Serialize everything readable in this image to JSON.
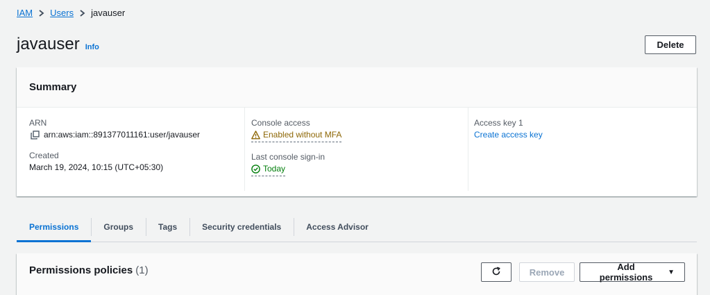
{
  "breadcrumb": {
    "items": [
      {
        "label": "IAM"
      },
      {
        "label": "Users"
      }
    ],
    "current": "javauser"
  },
  "header": {
    "title": "javauser",
    "info_label": "Info",
    "delete_label": "Delete"
  },
  "summary": {
    "title": "Summary",
    "arn_label": "ARN",
    "arn_value": "arn:aws:iam::891377011161:user/javauser",
    "created_label": "Created",
    "created_value": "March 19, 2024, 10:15 (UTC+05:30)",
    "console_access_label": "Console access",
    "console_access_value": "Enabled without MFA",
    "last_signin_label": "Last console sign-in",
    "last_signin_value": "Today",
    "access_key_label": "Access key 1",
    "access_key_link": "Create access key"
  },
  "tabs": [
    {
      "label": "Permissions",
      "active": true
    },
    {
      "label": "Groups",
      "active": false
    },
    {
      "label": "Tags",
      "active": false
    },
    {
      "label": "Security credentials",
      "active": false
    },
    {
      "label": "Access Advisor",
      "active": false
    }
  ],
  "permissions_panel": {
    "title": "Permissions policies",
    "count": "(1)",
    "remove_label": "Remove",
    "add_label": "Add permissions"
  },
  "colors": {
    "link": "#0972d3",
    "warning": "#8d6605",
    "success": "#037f0c",
    "background": "#f2f3f3"
  }
}
